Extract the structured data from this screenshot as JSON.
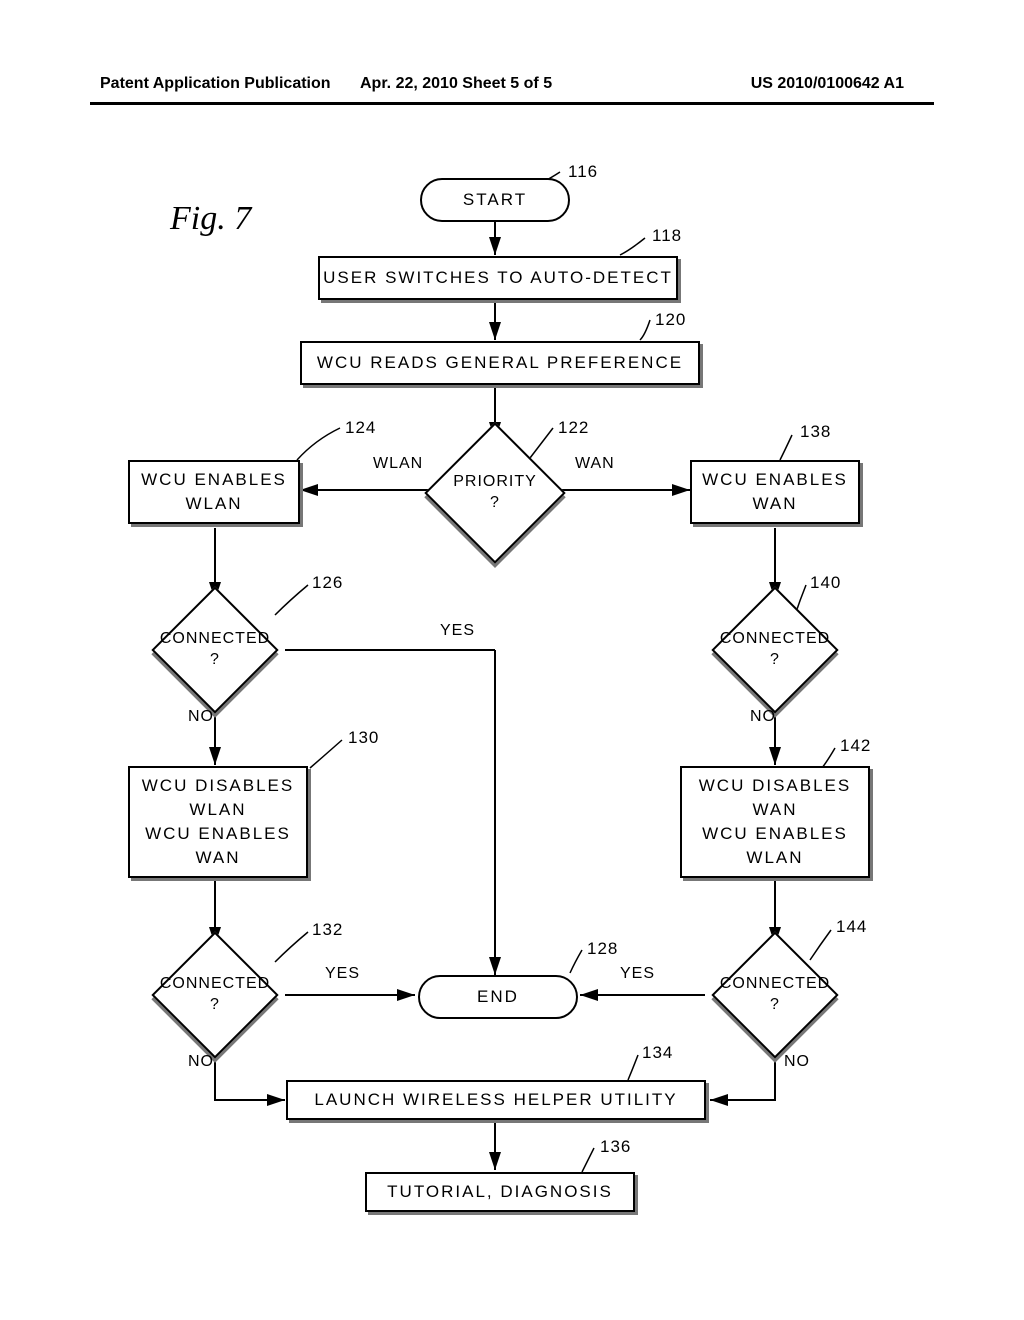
{
  "header": {
    "left": "Patent Application Publication",
    "center": "Apr. 22, 2010  Sheet 5 of 5",
    "right": "US 2010/0100642 A1"
  },
  "figure_label": "Fig. 7",
  "nodes": {
    "n116": "START",
    "n118": "USER SWITCHES TO AUTO-DETECT",
    "n120": "WCU READS GENERAL PREFERENCE",
    "n122": "PRIORITY\n?",
    "n124": "WCU ENABLES\nWLAN",
    "n126": "CONNECTED\n?",
    "n128": "END",
    "n130": "WCU DISABLES\nWLAN\nWCU ENABLES\nWAN",
    "n132": "CONNECTED\n?",
    "n134": "LAUNCH WIRELESS HELPER UTILITY",
    "n136": "TUTORIAL, DIAGNOSIS",
    "n138": "WCU ENABLES\nWAN",
    "n140": "CONNECTED\n?",
    "n142": "WCU DISABLES\nWAN\nWCU ENABLES\nWLAN",
    "n144": "CONNECTED\n?"
  },
  "refs": {
    "r116": "116",
    "r118": "118",
    "r120": "120",
    "r122": "122",
    "r124": "124",
    "r126": "126",
    "r128": "128",
    "r130": "130",
    "r132": "132",
    "r134": "134",
    "r136": "136",
    "r138": "138",
    "r140": "140",
    "r142": "142",
    "r144": "144"
  },
  "edges": {
    "wlan": "WLAN",
    "wan": "WAN",
    "yes": "YES",
    "no": "NO"
  }
}
